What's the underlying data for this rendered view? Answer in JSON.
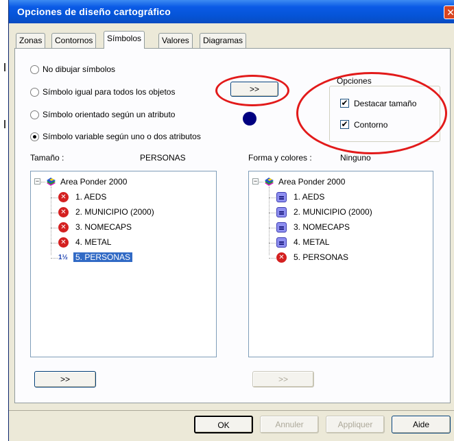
{
  "window": {
    "title": "Opciones de diseño cartográfico",
    "close_glyph": "✕"
  },
  "tabs": [
    {
      "label": "Zonas",
      "active": false
    },
    {
      "label": "Contornos",
      "active": false
    },
    {
      "label": "Símbolos",
      "active": true
    },
    {
      "label": "Valores",
      "active": false
    },
    {
      "label": "Diagramas",
      "active": false
    }
  ],
  "symbol_options": [
    {
      "label": "No dibujar símbolos",
      "checked": false
    },
    {
      "label": "Símbolo igual para todos los objetos",
      "checked": false
    },
    {
      "label": "Símbolo orientado según un atributo",
      "checked": false
    },
    {
      "label": "Símbolo variable según uno o dos atributos",
      "checked": true
    }
  ],
  "symbol_button": {
    "label": ">>"
  },
  "symbol_preview_color": "#000080",
  "opciones": {
    "legend": "Opciones",
    "destacar_tamano": {
      "label": "Destacar tamaño",
      "checked": true,
      "glyph": "✔"
    },
    "contorno": {
      "label": "Contorno",
      "checked": true,
      "glyph": "✔"
    }
  },
  "size_panel": {
    "label": "Tamaño :",
    "value": "PERSONAS",
    "expander": "−",
    "root": "Area Ponder 2000",
    "items": [
      {
        "label": "1. AEDS",
        "icon": "error-icon",
        "selected": false
      },
      {
        "label": "2. MUNICIPIO (2000)",
        "icon": "error-icon",
        "selected": false
      },
      {
        "label": "3. NOMECAPS",
        "icon": "error-icon",
        "selected": false
      },
      {
        "label": "4. METAL",
        "icon": "error-icon",
        "selected": false
      },
      {
        "label": "5. PERSONAS",
        "icon": "fraction-icon",
        "selected": true
      }
    ],
    "fraction_glyph": "1½",
    "button": {
      "label": ">>",
      "enabled": true
    }
  },
  "shape_panel": {
    "label": "Forma y colores :",
    "value": "Ninguno",
    "expander": "−",
    "root": "Area Ponder 2000",
    "items": [
      {
        "label": "1. AEDS",
        "icon": "list-icon"
      },
      {
        "label": "2. MUNICIPIO (2000)",
        "icon": "list-icon"
      },
      {
        "label": "3. NOMECAPS",
        "icon": "list-icon"
      },
      {
        "label": "4. METAL",
        "icon": "list-icon"
      },
      {
        "label": "5. PERSONAS",
        "icon": "error-icon"
      }
    ],
    "button": {
      "label": ">>",
      "enabled": false
    }
  },
  "error_glyph": "✕",
  "footer": {
    "ok": "OK",
    "annuler": "Annuler",
    "appliquer": "Appliquer",
    "aide": "Aide"
  },
  "colors": {
    "title_bar": "#0a5ae6",
    "highlight_circle": "#e21a1a",
    "selection": "#316ac5",
    "error_icon": "#d42020"
  }
}
